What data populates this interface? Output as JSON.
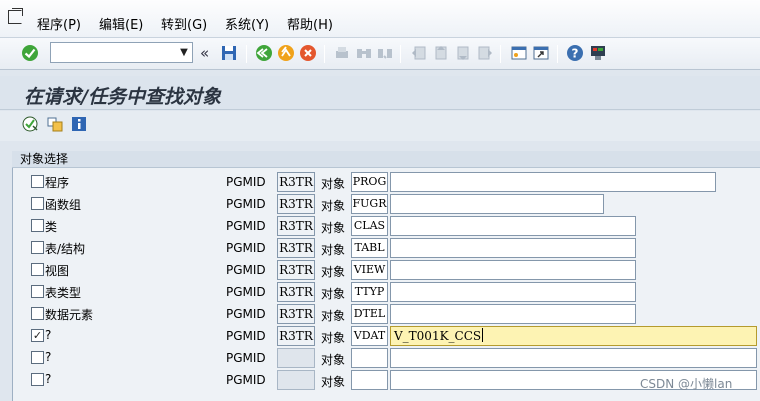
{
  "menu": [
    "程序(P)",
    "编辑(E)",
    "转到(G)",
    "系统(Y)",
    "帮助(H)"
  ],
  "menu_hotkeys": [
    "P",
    "E",
    "G",
    "Y",
    "H"
  ],
  "toolbar": {
    "command_value": "",
    "nav_back": "«"
  },
  "title": "在请求/任务中查找对象",
  "group_title": "对象选择",
  "object_label": "对象",
  "rows": [
    {
      "checked": false,
      "label": "程序",
      "pgmid": "PGMID",
      "object": "R3TR",
      "type": "PROG",
      "value": ""
    },
    {
      "checked": false,
      "label": "函数组",
      "pgmid": "PGMID",
      "object": "R3TR",
      "type": "FUGR",
      "value": ""
    },
    {
      "checked": false,
      "label": "类",
      "pgmid": "PGMID",
      "object": "R3TR",
      "type": "CLAS",
      "value": ""
    },
    {
      "checked": false,
      "label": "表/结构",
      "pgmid": "PGMID",
      "object": "R3TR",
      "type": "TABL",
      "value": ""
    },
    {
      "checked": false,
      "label": "视图",
      "pgmid": "PGMID",
      "object": "R3TR",
      "type": "VIEW",
      "value": ""
    },
    {
      "checked": false,
      "label": "表类型",
      "pgmid": "PGMID",
      "object": "R3TR",
      "type": "TTYP",
      "value": ""
    },
    {
      "checked": false,
      "label": "数据元素",
      "pgmid": "PGMID",
      "object": "R3TR",
      "type": "DTEL",
      "value": ""
    },
    {
      "checked": true,
      "label": "?",
      "pgmid": "PGMID",
      "object": "R3TR",
      "type": "VDAT",
      "value": "V_T001K_CCS"
    },
    {
      "checked": false,
      "label": "?",
      "pgmid": "PGMID",
      "object": "",
      "type": "",
      "value": ""
    },
    {
      "checked": false,
      "label": "?",
      "pgmid": "PGMID",
      "object": "",
      "type": "",
      "value": ""
    }
  ],
  "checkmark": "✓",
  "watermark": "CSDN @小懒lan",
  "colors": {
    "active_field": "#fdf3b3",
    "ok_green": "#3fa53a",
    "title_text": "#2b3441"
  }
}
